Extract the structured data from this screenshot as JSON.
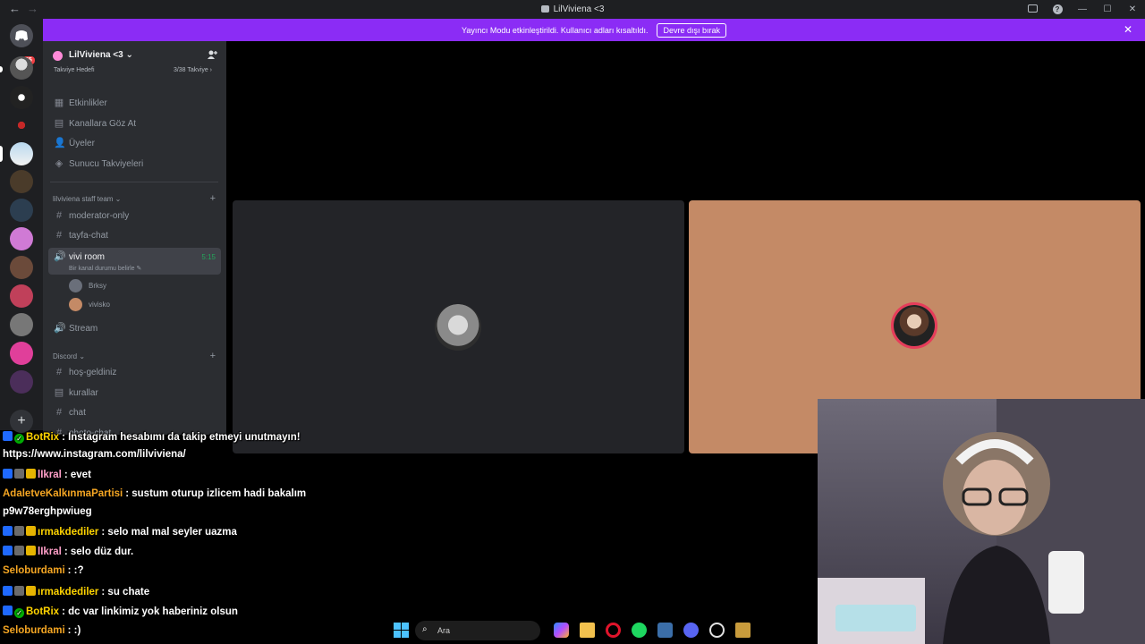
{
  "titlebar": {
    "title": "LilViviena <3",
    "back": "←",
    "forward": "→",
    "min": "—",
    "max": "☐",
    "close": "✕",
    "help": "?"
  },
  "rail": {
    "dm_badge": "55",
    "add": "+"
  },
  "banner": {
    "text": "Yayıncı Modu etkinleştirildi. Kullanıcı adları kısaltıldı.",
    "button": "Devre dışı bırak",
    "close": "✕"
  },
  "sidebar": {
    "server_name": "LilViviena <3",
    "chevron": "⌄",
    "boost_left": "Takviye Hedefi",
    "boost_right": "3/38 Takviye  ›",
    "nav": [
      {
        "label": "Etkinlikler",
        "icon": "calendar-icon",
        "glyph": "▦"
      },
      {
        "label": "Kanallara Göz At",
        "icon": "browse-channels-icon",
        "glyph": "▤"
      },
      {
        "label": "Üyeler",
        "icon": "members-icon",
        "glyph": "👤"
      },
      {
        "label": "Sunucu Takviyeleri",
        "icon": "boost-icon",
        "glyph": "◈"
      }
    ],
    "category1": "lilviviena staff team ⌄",
    "category1_plus": "+",
    "channels1": [
      {
        "label": "moderator-only",
        "glyph": "#"
      },
      {
        "label": "tayfa-chat",
        "glyph": "#"
      }
    ],
    "active_voice": {
      "label": "vivi room",
      "status": "Bir kanal durumu belirle ✎",
      "time": "5:15",
      "glyph": "🔊"
    },
    "voice_users": [
      "Brksy",
      "vivisko"
    ],
    "stream": {
      "label": "Stream",
      "glyph": "🔊"
    },
    "category2": "Discord ⌄",
    "category2_plus": "+",
    "channels2": [
      {
        "label": "hoş-geldiniz",
        "glyph": "#"
      },
      {
        "label": "kurallar",
        "glyph": "▤"
      },
      {
        "label": "chat",
        "glyph": "#"
      },
      {
        "label": "photo-chat",
        "glyph": "#"
      }
    ]
  },
  "chat": {
    "messages": [
      {
        "user": "BotRix",
        "color": "#ffd400",
        "badges": [
          "prime",
          "mod"
        ],
        "text": ": Instagram hesabımı da takip etmeyi unutmayın!"
      },
      {
        "user": "",
        "color": "#ffffff",
        "badges": [],
        "text": "https://www.instagram.com/lilviviena/"
      },
      {
        "user": "lIkral",
        "color": "#ff9fc8",
        "badges": [
          "prime",
          "sub",
          "gold"
        ],
        "text": ": evet"
      },
      {
        "user": "AdaletveKalkınmaPartisi",
        "color": "#f5a623",
        "badges": [],
        "text": ": sustum oturup izlicem hadi bakalım"
      },
      {
        "user": "",
        "color": "#ffffff",
        "badges": [],
        "text": "p9w78erghpwiueg"
      },
      {
        "user": "ırmakdediler",
        "color": "#ffd400",
        "badges": [
          "prime",
          "sub",
          "gold"
        ],
        "text": ": selo mal mal seyler uazma"
      },
      {
        "user": "lIkral",
        "color": "#ff9fc8",
        "badges": [
          "prime",
          "sub",
          "gold"
        ],
        "text": ": selo düz dur."
      },
      {
        "user": "Seloburdami",
        "color": "#f5a623",
        "badges": [],
        "text": ": :?"
      },
      {
        "user": "ırmakdediler",
        "color": "#ffd400",
        "badges": [
          "prime",
          "sub",
          "gold"
        ],
        "text": ": su chate"
      },
      {
        "user": "BotRix",
        "color": "#ffd400",
        "badges": [
          "prime",
          "mod"
        ],
        "text": ": dc var linkimiz yok haberiniz olsun"
      },
      {
        "user": "Seloburdami",
        "color": "#f5a623",
        "badges": [],
        "text": ": :)"
      }
    ]
  },
  "taskbar": {
    "search_placeholder": "Ara",
    "search_glyph": "⌕"
  }
}
